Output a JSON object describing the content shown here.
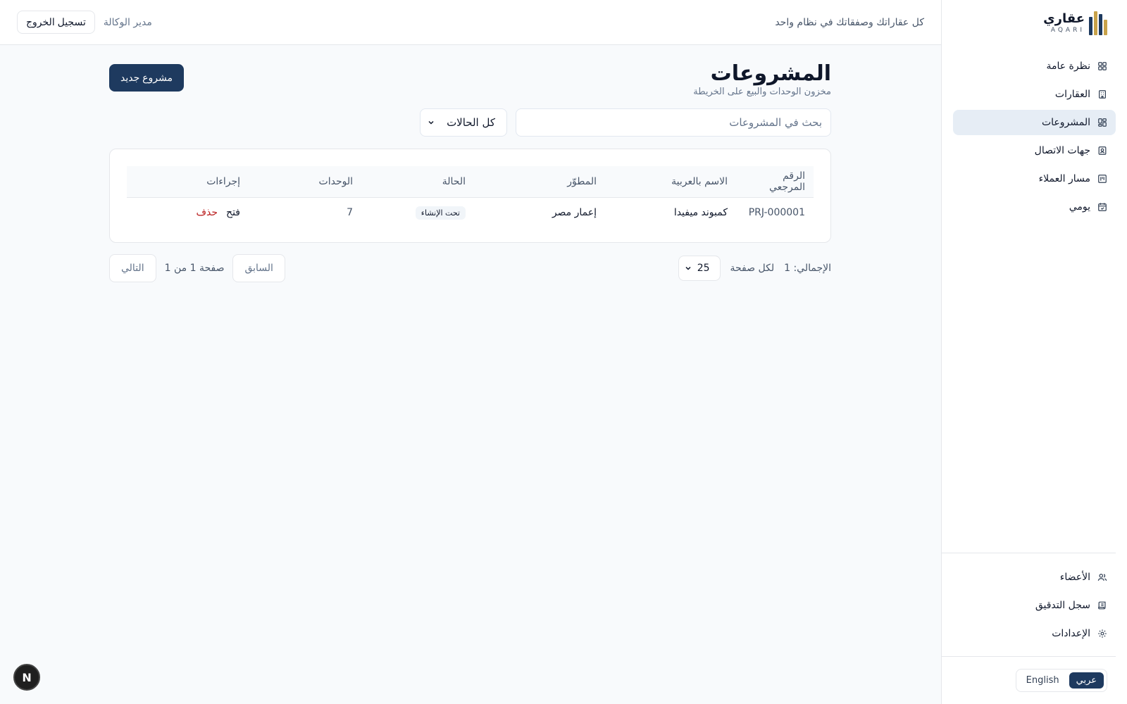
{
  "brand": {
    "name_ar": "عقاري",
    "name_en": "AQARI"
  },
  "header": {
    "tagline": "كل عقاراتك وصفقاتك في نظام واحد",
    "role": "مدير الوكالة",
    "logout_label": "تسجيل الخروج"
  },
  "sidebar": {
    "items": [
      {
        "label": "نظرة عامة",
        "icon": "grid-icon",
        "active": false
      },
      {
        "label": "العقارات",
        "icon": "building-icon",
        "active": false
      },
      {
        "label": "المشروعات",
        "icon": "projects-icon",
        "active": true
      },
      {
        "label": "جهات الاتصال",
        "icon": "contact-card-icon",
        "active": false
      },
      {
        "label": "مسار العملاء",
        "icon": "pipeline-icon",
        "active": false
      },
      {
        "label": "يومي",
        "icon": "calendar-icon",
        "active": false
      }
    ],
    "bottom_items": [
      {
        "label": "الأعضاء",
        "icon": "users-icon"
      },
      {
        "label": "سجل التدقيق",
        "icon": "scroll-icon"
      },
      {
        "label": "الإعدادات",
        "icon": "gear-icon"
      }
    ],
    "lang": {
      "arabic": "عربي",
      "english": "English",
      "active": "arabic"
    }
  },
  "page": {
    "title": "المشروعات",
    "subtitle": "مخزون الوحدات والبيع على الخريطة",
    "new_button": "مشروع جديد"
  },
  "filters": {
    "search_placeholder": "بحث في المشروعات",
    "status_value": "كل الحالات"
  },
  "table": {
    "headers": [
      "الرقم المرجعي",
      "الاسم بالعربية",
      "المطوّر",
      "الحالة",
      "الوحدات",
      "إجراءات"
    ],
    "rows": [
      {
        "ref": "PRJ-000001",
        "name_ar": "كمبوند ميفيدا",
        "developer": "إعمار مصر",
        "status": "تحت الإنشاء",
        "units": "7",
        "open": "فتح",
        "delete": "حذف"
      }
    ]
  },
  "pagination": {
    "total": "الإجمالي: 1",
    "per_page_label": "لكل صفحة",
    "per_page_value": "25",
    "prev": "السابق",
    "page_info": "صفحة 1 من 1",
    "next": "التالي"
  },
  "colors": {
    "primary": "#1e3a5f",
    "accent": "#c8a24a",
    "danger": "#b91c1c",
    "active_nav_bg": "#e6edf5"
  }
}
